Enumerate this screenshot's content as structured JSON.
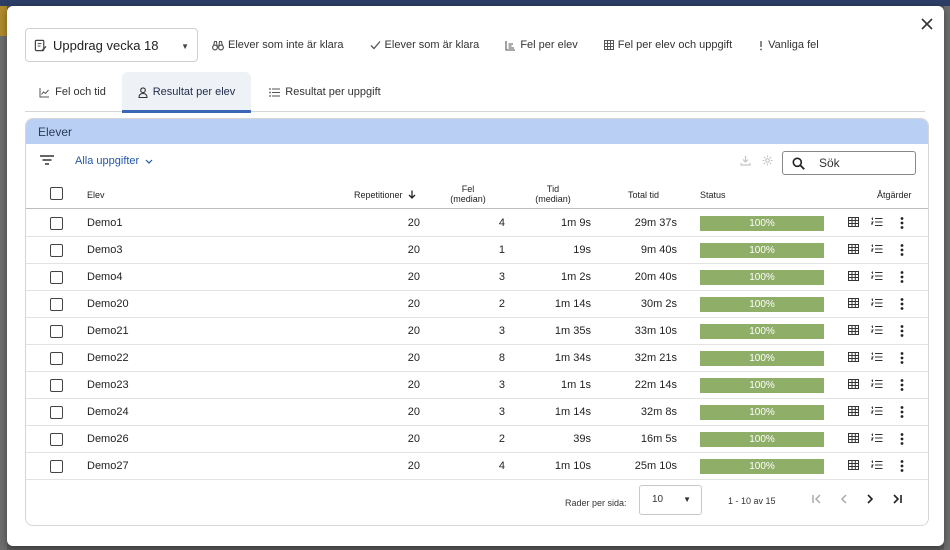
{
  "assignment": {
    "title": "Uppdrag vecka 18"
  },
  "toolbar": [
    {
      "label": "Elever som inte är klara",
      "icon": "binoculars-icon"
    },
    {
      "label": "Elever som är klara",
      "icon": "check-icon"
    },
    {
      "label": "Fel per elev",
      "icon": "bar-chart-icon"
    },
    {
      "label": "Fel per elev och uppgift",
      "icon": "grid-icon"
    },
    {
      "label": "Vanliga fel",
      "icon": "exclamation-icon"
    }
  ],
  "tabs": [
    {
      "label": "Fel och tid",
      "icon": "line-chart-icon"
    },
    {
      "label": "Resultat per elev",
      "icon": "person-icon",
      "active": true
    },
    {
      "label": "Resultat per uppgift",
      "icon": "list-icon"
    }
  ],
  "panel": {
    "title": "Elever",
    "task_filter": "Alla uppgifter",
    "search_placeholder": "Sök"
  },
  "table": {
    "columns": {
      "student": "Elev",
      "repetitions": "Repetitioner",
      "errors_line1": "Fel",
      "errors_line2": "(median)",
      "time_line1": "Tid",
      "time_line2": "(median)",
      "total_time": "Total tid",
      "status": "Status",
      "actions": "Åtgärder"
    },
    "rows": [
      {
        "student": "Demo1",
        "repetitions": "20",
        "errors": "4",
        "time": "1m 9s",
        "total": "29m 37s",
        "status": "100%",
        "progress": 1.0
      },
      {
        "student": "Demo3",
        "repetitions": "20",
        "errors": "1",
        "time": "19s",
        "total": "9m 40s",
        "status": "100%",
        "progress": 1.0
      },
      {
        "student": "Demo4",
        "repetitions": "20",
        "errors": "3",
        "time": "1m 2s",
        "total": "20m 40s",
        "status": "100%",
        "progress": 1.0
      },
      {
        "student": "Demo20",
        "repetitions": "20",
        "errors": "2",
        "time": "1m 14s",
        "total": "30m 2s",
        "status": "100%",
        "progress": 1.0
      },
      {
        "student": "Demo21",
        "repetitions": "20",
        "errors": "3",
        "time": "1m 35s",
        "total": "33m 10s",
        "status": "100%",
        "progress": 1.0
      },
      {
        "student": "Demo22",
        "repetitions": "20",
        "errors": "8",
        "time": "1m 34s",
        "total": "32m 21s",
        "status": "100%",
        "progress": 1.0
      },
      {
        "student": "Demo23",
        "repetitions": "20",
        "errors": "3",
        "time": "1m 1s",
        "total": "22m 14s",
        "status": "100%",
        "progress": 1.0
      },
      {
        "student": "Demo24",
        "repetitions": "20",
        "errors": "3",
        "time": "1m 14s",
        "total": "32m 8s",
        "status": "100%",
        "progress": 1.0
      },
      {
        "student": "Demo26",
        "repetitions": "20",
        "errors": "2",
        "time": "39s",
        "total": "16m 5s",
        "status": "100%",
        "progress": 1.0
      },
      {
        "student": "Demo27",
        "repetitions": "20",
        "errors": "4",
        "time": "1m 10s",
        "total": "25m 10s",
        "status": "100%",
        "progress": 1.0
      }
    ]
  },
  "pagination": {
    "rows_per_page_label": "Rader per sida:",
    "rows_per_page": "10",
    "range": "1 - 10 av 15"
  },
  "colors": {
    "panel_header": "#b9d0f4",
    "status_complete": "#8fae68",
    "active_tab_indicator": "#3a68b6",
    "link": "#2457a8"
  }
}
